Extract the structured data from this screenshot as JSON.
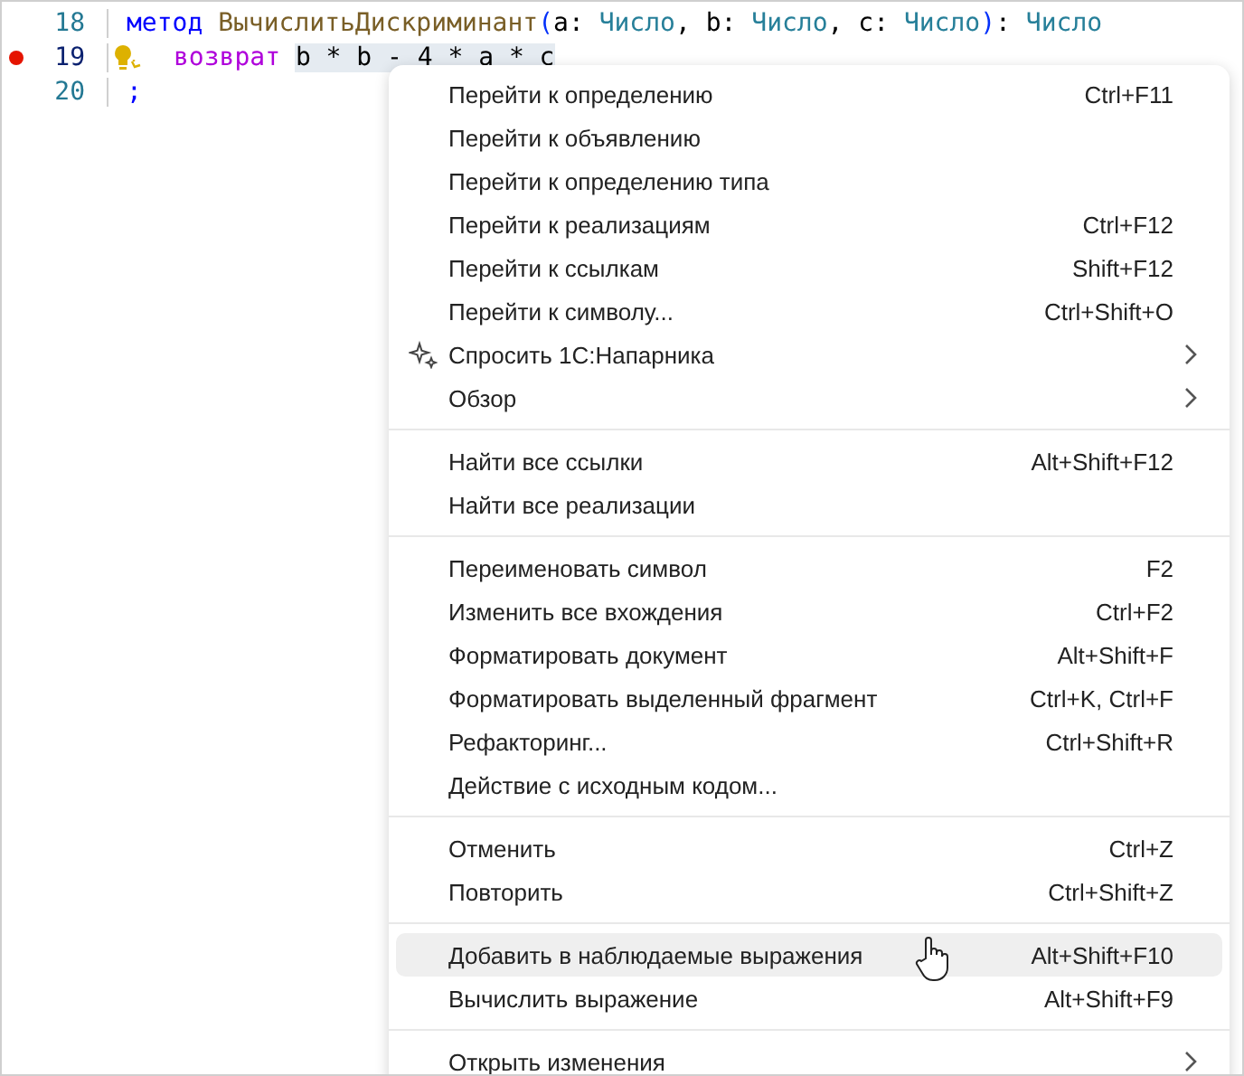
{
  "editor": {
    "lines": [
      {
        "number": "18",
        "breakpoint": false,
        "current": false,
        "lightbulb": false,
        "tokens": [
          {
            "kind": "keyword",
            "text": "метод "
          },
          {
            "kind": "function",
            "text": "ВычислитьДискриминант"
          },
          {
            "kind": "paren",
            "text": "("
          },
          {
            "kind": "plain",
            "text": "a: "
          },
          {
            "kind": "type",
            "text": "Число"
          },
          {
            "kind": "plain",
            "text": ", b: "
          },
          {
            "kind": "type",
            "text": "Число"
          },
          {
            "kind": "plain",
            "text": ", c: "
          },
          {
            "kind": "type",
            "text": "Число"
          },
          {
            "kind": "paren",
            "text": ")"
          },
          {
            "kind": "plain",
            "text": ": "
          },
          {
            "kind": "type",
            "text": "Число"
          }
        ]
      },
      {
        "number": "19",
        "breakpoint": true,
        "current": true,
        "lightbulb": true,
        "tokens": [
          {
            "kind": "return",
            "text": "возврат "
          },
          {
            "kind": "selected",
            "text": "b * b - 4 * a * c"
          }
        ]
      },
      {
        "number": "20",
        "breakpoint": false,
        "current": false,
        "lightbulb": false,
        "tokens": [
          {
            "kind": "keyword",
            "text": ";"
          }
        ]
      }
    ]
  },
  "context_menu": {
    "groups": [
      [
        {
          "label": "Перейти к определению",
          "shortcut": "Ctrl+F11",
          "submenu": false,
          "highlighted": false
        },
        {
          "label": "Перейти к объявлению",
          "submenu": false,
          "highlighted": false
        },
        {
          "label": "Перейти к определению типа",
          "submenu": false,
          "highlighted": false
        },
        {
          "label": "Перейти к реализациям",
          "shortcut": "Ctrl+F12",
          "submenu": false,
          "highlighted": false
        },
        {
          "label": "Перейти к ссылкам",
          "shortcut": "Shift+F12",
          "submenu": false,
          "highlighted": false
        },
        {
          "label": "Перейти к символу...",
          "shortcut": "Ctrl+Shift+O",
          "submenu": false,
          "highlighted": false
        },
        {
          "label": "Спросить 1С:Напарника",
          "kind": "ai",
          "submenu": true,
          "highlighted": false
        },
        {
          "label": "Обзор",
          "submenu": true,
          "highlighted": false
        }
      ],
      [
        {
          "label": "Найти все ссылки",
          "shortcut": "Alt+Shift+F12",
          "submenu": false,
          "highlighted": false
        },
        {
          "label": "Найти все реализации",
          "submenu": false,
          "highlighted": false
        }
      ],
      [
        {
          "label": "Переименовать символ",
          "shortcut": "F2",
          "submenu": false,
          "highlighted": false
        },
        {
          "label": "Изменить все вхождения",
          "shortcut": "Ctrl+F2",
          "submenu": false,
          "highlighted": false
        },
        {
          "label": "Форматировать документ",
          "shortcut": "Alt+Shift+F",
          "submenu": false,
          "highlighted": false
        },
        {
          "label": "Форматировать выделенный фрагмент",
          "shortcut": "Ctrl+K, Ctrl+F",
          "submenu": false,
          "highlighted": false
        },
        {
          "label": "Рефакторинг...",
          "shortcut": "Ctrl+Shift+R",
          "submenu": false,
          "highlighted": false
        },
        {
          "label": "Действие с исходным кодом...",
          "submenu": false,
          "highlighted": false
        }
      ],
      [
        {
          "label": "Отменить",
          "shortcut": "Ctrl+Z",
          "submenu": false,
          "highlighted": false
        },
        {
          "label": "Повторить",
          "shortcut": "Ctrl+Shift+Z",
          "submenu": false,
          "highlighted": false
        }
      ],
      [
        {
          "label": "Добавить в наблюдаемые выражения",
          "shortcut": "Alt+Shift+F10",
          "submenu": false,
          "highlighted": true
        },
        {
          "label": "Вычислить выражение",
          "shortcut": "Alt+Shift+F9",
          "submenu": false,
          "highlighted": false
        }
      ],
      [
        {
          "label": "Открыть изменения",
          "submenu": true,
          "highlighted": false
        }
      ]
    ]
  }
}
